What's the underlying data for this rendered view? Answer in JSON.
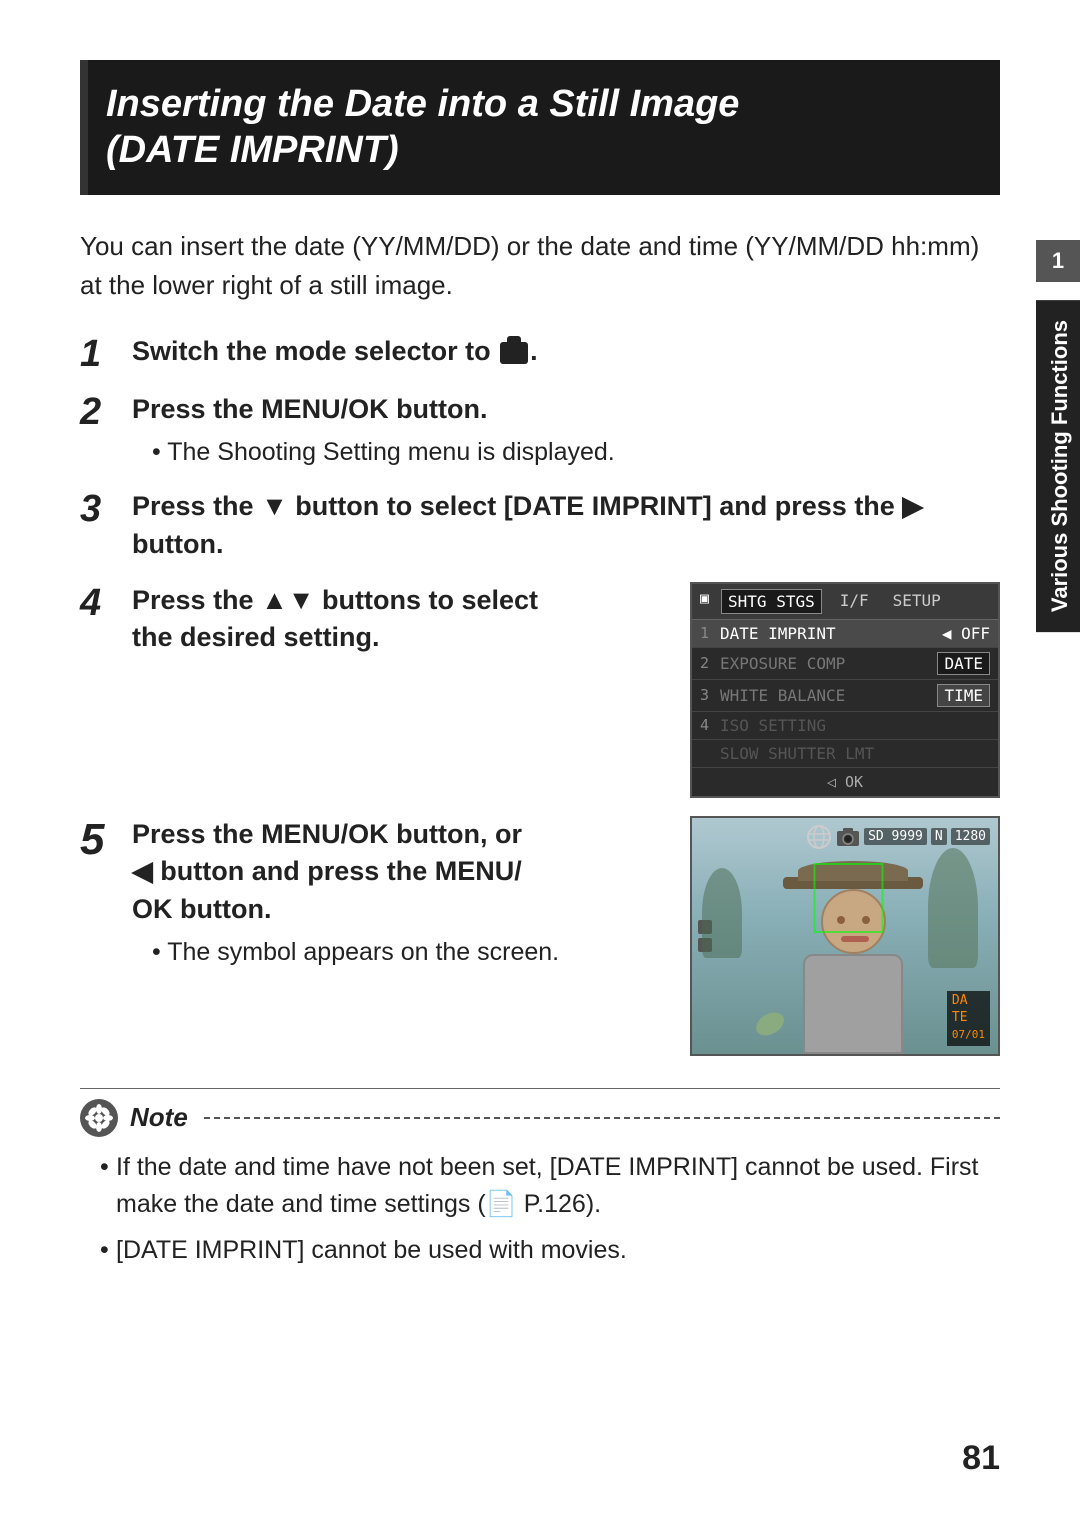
{
  "page": {
    "number": "81"
  },
  "sidetab": {
    "label": "Various Shooting Functions",
    "number": "1"
  },
  "title": {
    "line1": "Inserting the Date into a Still Image",
    "line2": "(DATE IMPRINT)"
  },
  "intro": "You can insert the date (YY/MM/DD) or the date and time (YY/MM/DD hh:mm) at the lower right of a still image.",
  "steps": [
    {
      "number": "1",
      "text": "Switch the mode selector to ",
      "icon": "camera"
    },
    {
      "number": "2",
      "text": "Press the MENU/OK button.",
      "sub": "The Shooting Setting menu is displayed."
    },
    {
      "number": "3",
      "text": "Press the ▼ button to select [DATE IMPRINT] and press the ▶ button."
    },
    {
      "number": "4",
      "text": "Press the ▲▼ buttons to select the desired setting."
    },
    {
      "number": "5",
      "text": "Press the MENU/OK button, or ◀ button and press the MENU/OK button.",
      "sub": "The symbol appears on the screen."
    }
  ],
  "menu_screenshot": {
    "tabs": [
      "SHTG STGS",
      "I/F",
      "SETUP"
    ],
    "active_tab": "SHTG STGS",
    "rows": [
      {
        "num": "1",
        "label": "DATE IMPRINT",
        "value": "OFF",
        "highlighted": true
      },
      {
        "num": "2",
        "label": "EXPOSURE COMP",
        "value": "",
        "highlighted": false
      },
      {
        "num": "3",
        "label": "WHITE BALANCE",
        "value": "",
        "highlighted": false
      },
      {
        "num": "4",
        "label": "ISO SETTING",
        "value": "",
        "highlighted": false
      },
      {
        "num": "",
        "label": "SLOW SHUTTER LMT",
        "value": "",
        "highlighted": false
      }
    ],
    "options": [
      "OFF",
      "DATE",
      "TIME"
    ],
    "selected_option": "OFF",
    "bottom": "◁ OK"
  },
  "viewfinder": {
    "top_right": "SD 9999 N 1280",
    "date_stamp": "DA TE 07/01"
  },
  "note": {
    "title": "Note",
    "items": [
      "If the date and time have not been set, [DATE IMPRINT] cannot be used. First make the date and time settings (☞ P.126).",
      "[DATE IMPRINT] cannot be used with movies."
    ]
  }
}
